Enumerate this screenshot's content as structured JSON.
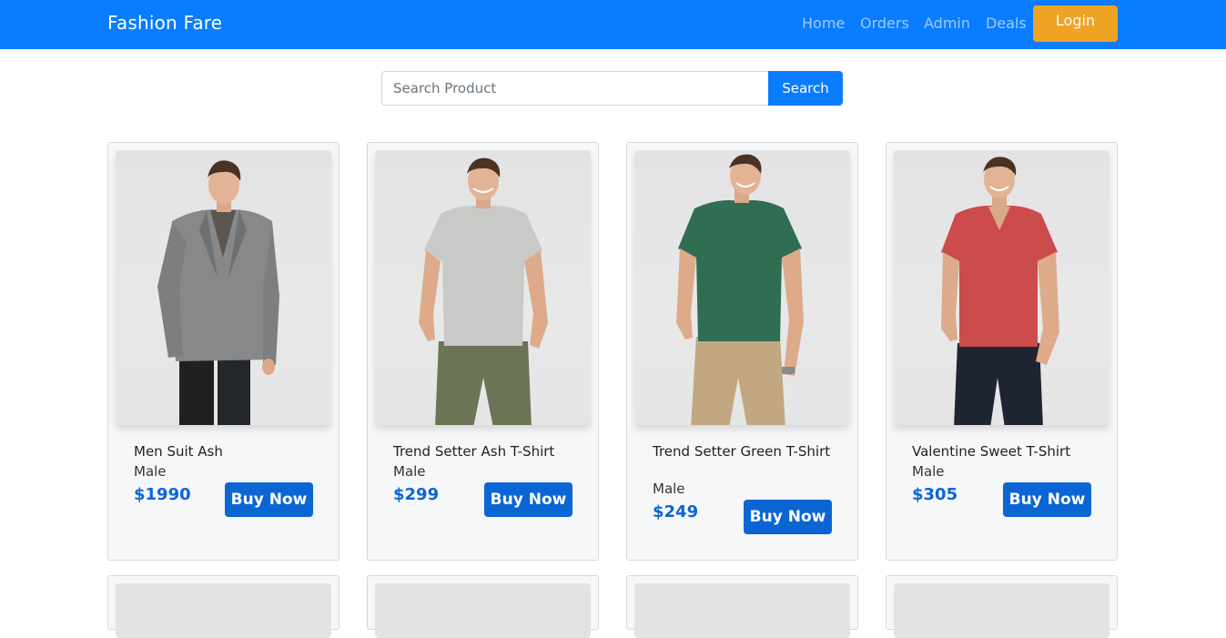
{
  "navbar": {
    "brand": "Fashion Fare",
    "links": [
      "Home",
      "Orders",
      "Admin",
      "Deals"
    ],
    "login": "Login"
  },
  "search": {
    "placeholder": "Search Product",
    "value": "",
    "button": "Search"
  },
  "products": [
    {
      "name": "Men Suit Ash",
      "gender": "Male",
      "price": "$1990",
      "buy": "Buy Now",
      "image": "man-in-grey-blazer"
    },
    {
      "name": "Trend Setter Ash T-Shirt",
      "gender": "Male",
      "price": "$299",
      "buy": "Buy Now",
      "image": "man-in-grey-tshirt"
    },
    {
      "name": "Trend Setter Green T-Shirt",
      "gender": "Male",
      "price": "$249",
      "buy": "Buy Now",
      "image": "man-in-green-tshirt"
    },
    {
      "name": "Valentine Sweet T-Shirt",
      "gender": "Male",
      "price": "$305",
      "buy": "Buy Now",
      "image": "man-in-red-tshirt"
    }
  ],
  "colors": {
    "navbar": "#0a7cff",
    "login": "#efa325",
    "price": "#0b66d4",
    "buy_button": "#0b66d4"
  }
}
